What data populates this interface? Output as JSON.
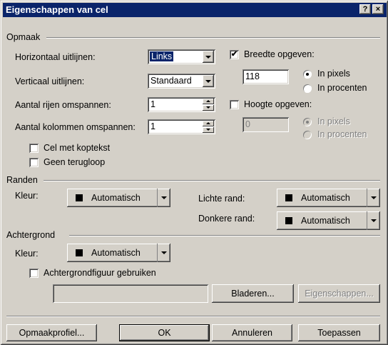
{
  "window": {
    "title": "Eigenschappen van cel",
    "help_glyph": "?",
    "close_glyph": "×"
  },
  "opmaak": {
    "group_label": "Opmaak",
    "horiz_label": "Horizontaal uitlijnen:",
    "horiz_value": "Links",
    "vert_label": "Verticaal uitlijnen:",
    "vert_value": "Standaard",
    "rows_label": "Aantal rijen omspannen:",
    "rows_value": "1",
    "cols_label": "Aantal kolommen omspannen:",
    "cols_value": "1",
    "header_cell_label": "Cel met koptekst",
    "header_cell_checked": false,
    "no_wrap_label": "Geen terugloop",
    "no_wrap_checked": false,
    "width_label": "Breedte opgeven:",
    "width_checked": true,
    "width_value": "118",
    "width_px_label": "In pixels",
    "width_pct_label": "In procenten",
    "height_label": "Hoogte opgeven:",
    "height_checked": false,
    "height_value": "0",
    "height_px_label": "In pixels",
    "height_pct_label": "In procenten",
    "check_glyph": "✔"
  },
  "randen": {
    "group_label": "Randen",
    "color_label": "Kleur:",
    "color_value": "Automatisch",
    "light_label": "Lichte rand:",
    "light_value": "Automatisch",
    "dark_label": "Donkere rand:",
    "dark_value": "Automatisch"
  },
  "achtergrond": {
    "group_label": "Achtergrond",
    "color_label": "Kleur:",
    "color_value": "Automatisch",
    "image_label": "Achtergrondfiguur gebruiken",
    "image_checked": false,
    "image_path": "",
    "browse_label": "Bladeren...",
    "props_label": "Eigenschappen..."
  },
  "footer": {
    "style_label": "Opmaakprofiel...",
    "ok_label": "OK",
    "cancel_label": "Annuleren",
    "apply_label": "Toepassen"
  }
}
